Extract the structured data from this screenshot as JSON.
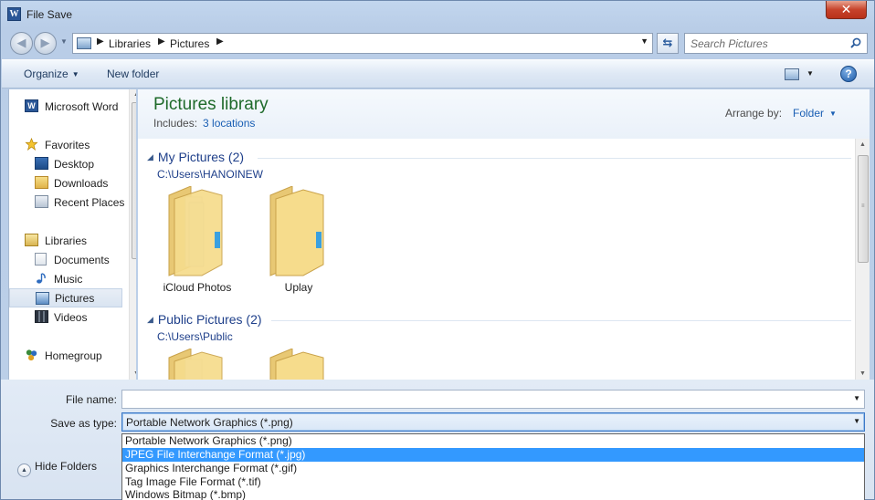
{
  "window": {
    "title": "File Save",
    "close_label": "✕",
    "app_icon_letter": "W"
  },
  "address": {
    "crumbs": [
      "Libraries",
      "Pictures"
    ],
    "search_placeholder": "Search Pictures"
  },
  "toolbar": {
    "organize": "Organize",
    "new_folder": "New folder",
    "help": "?"
  },
  "nav": {
    "items": [
      {
        "label": "Microsoft Word",
        "icon": "word-icon"
      },
      {
        "label": "Favorites",
        "icon": "star-icon"
      },
      {
        "label": "Desktop",
        "icon": "desktop-icon"
      },
      {
        "label": "Downloads",
        "icon": "downloads-icon"
      },
      {
        "label": "Recent Places",
        "icon": "recent-places-icon"
      },
      {
        "label": "Libraries",
        "icon": "libraries-icon"
      },
      {
        "label": "Documents",
        "icon": "documents-icon"
      },
      {
        "label": "Music",
        "icon": "music-icon"
      },
      {
        "label": "Pictures",
        "icon": "pictures-icon",
        "selected": true
      },
      {
        "label": "Videos",
        "icon": "videos-icon"
      },
      {
        "label": "Homegroup",
        "icon": "homegroup-icon"
      }
    ]
  },
  "library": {
    "title": "Pictures library",
    "includes_label": "Includes:",
    "includes_link": "3 locations",
    "arrange_label": "Arrange by:",
    "arrange_value": "Folder"
  },
  "groups": [
    {
      "name": "My Pictures (2)",
      "path": "C:\\Users\\HANOINEW",
      "folders": [
        "iCloud Photos",
        "Uplay"
      ]
    },
    {
      "name": "Public Pictures (2)",
      "path": "C:\\Users\\Public",
      "folders": [
        "",
        ""
      ]
    }
  ],
  "form": {
    "file_name_label": "File name:",
    "file_name_value": "",
    "save_type_label": "Save as type:",
    "save_type_value": "Portable Network Graphics (*.png)",
    "options": [
      "Portable Network Graphics (*.png)",
      "JPEG File Interchange Format (*.jpg)",
      "Graphics Interchange Format (*.gif)",
      "Tag Image File Format (*.tif)",
      "Windows Bitmap (*.bmp)"
    ],
    "highlighted_option_index": 1,
    "hide_folders": "Hide Folders"
  },
  "colors": {
    "library_title": "#1e6a2a",
    "group_heading": "#1e3f8a",
    "selection": "#3399ff",
    "close_button": "#c7432b"
  }
}
